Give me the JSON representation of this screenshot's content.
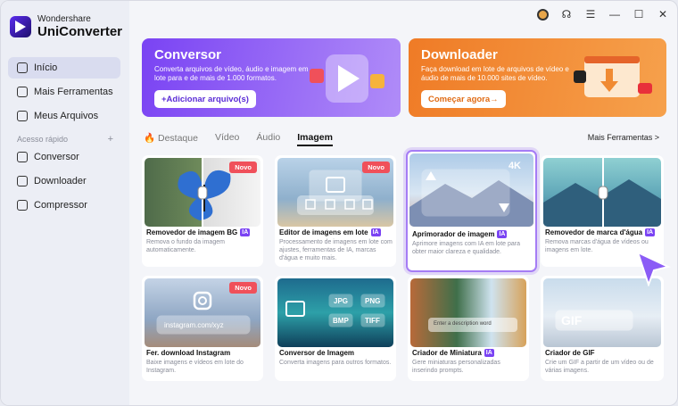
{
  "app": {
    "brand": "Wondershare",
    "name": "UniConverter"
  },
  "sidebar": {
    "items": [
      {
        "label": "Início"
      },
      {
        "label": "Mais Ferramentas"
      },
      {
        "label": "Meus Arquivos"
      }
    ],
    "section_label": "Acesso rápido",
    "section_plus": "+",
    "quick": [
      {
        "label": "Conversor"
      },
      {
        "label": "Downloader"
      },
      {
        "label": "Compressor"
      }
    ]
  },
  "banners": {
    "converter": {
      "title": "Conversor",
      "desc": "Converta arquivos de vídeo, áudio e imagem em lote para e de mais de 1.000 formatos.",
      "button": "+Adicionar arquivo(s)"
    },
    "downloader": {
      "title": "Downloader",
      "desc": "Faça download em lote de arquivos de vídeo e áudio de mais de 10.000 sites de vídeo.",
      "button": "Começar agora→"
    }
  },
  "tabs": [
    {
      "label": "Destaque"
    },
    {
      "label": "Vídeo"
    },
    {
      "label": "Áudio"
    },
    {
      "label": "Imagem"
    }
  ],
  "more_tools": "Mais Ferramentas >",
  "cards": [
    {
      "title": "Removedor de imagem BG",
      "ia": "IA",
      "badge": "Novo",
      "desc": "Remova o fundo da imagem automaticamente."
    },
    {
      "title": "Editor de imagens em lote",
      "ia": "IA",
      "badge": "Novo",
      "desc": "Processamento de imagens em lote com ajustes, ferramentas de IA, marcas d'água e muito mais."
    },
    {
      "title": "Aprimorador de imagem",
      "ia": "IA",
      "badge": "4K",
      "desc": "Aprimore imagens com IA em lote para obter maior clareza e qualidade."
    },
    {
      "title": "Removedor de marca d'água",
      "ia": "IA",
      "desc": "Remova marcas d'água de vídeos ou imagens em lote."
    },
    {
      "title": "Fer. download Instagram",
      "badge": "Novo",
      "desc": "Baixe imagens e vídeos em lote do Instagram.",
      "url": "instagram.com/xyz"
    },
    {
      "title": "Conversor de Imagem",
      "desc": "Converta imagens para outros formatos.",
      "formats": [
        "JPG",
        "PNG",
        "BMP",
        "TIFF"
      ]
    },
    {
      "title": "Criador de Miniatura",
      "ia": "IA",
      "desc": "Gere miniaturas personalizadas inserindo prompts.",
      "prompt": "Enter a description word"
    },
    {
      "title": "Criador de GIF",
      "desc": "Crie um GIF a partir de um vídeo ou de várias imagens.",
      "gif": "GIF"
    }
  ],
  "colors": {
    "accent": "#7a43f3",
    "badge": "#f0505a",
    "orange": "#ef7b26"
  }
}
